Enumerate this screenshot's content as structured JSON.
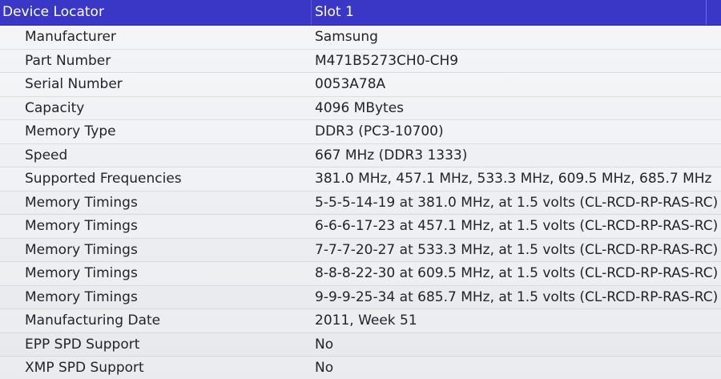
{
  "header": {
    "field": "Device Locator",
    "value": "Slot 1"
  },
  "rows": [
    {
      "field": "Manufacturer",
      "value": "Samsung"
    },
    {
      "field": "Part Number",
      "value": "M471B5273CH0-CH9"
    },
    {
      "field": "Serial Number",
      "value": "0053A78A"
    },
    {
      "field": "Capacity",
      "value": "4096 MBytes"
    },
    {
      "field": "Memory Type",
      "value": "DDR3 (PC3-10700)"
    },
    {
      "field": "Speed",
      "value": "667 MHz (DDR3 1333)"
    },
    {
      "field": "Supported Frequencies",
      "value": "381.0 MHz, 457.1 MHz, 533.3 MHz, 609.5 MHz, 685.7 MHz"
    },
    {
      "field": "Memory Timings",
      "value": "5-5-5-14-19 at 381.0 MHz, at 1.5 volts (CL-RCD-RP-RAS-RC)"
    },
    {
      "field": "Memory Timings",
      "value": "6-6-6-17-23 at 457.1 MHz, at 1.5 volts (CL-RCD-RP-RAS-RC)"
    },
    {
      "field": "Memory Timings",
      "value": "7-7-7-20-27 at 533.3 MHz, at 1.5 volts (CL-RCD-RP-RAS-RC)"
    },
    {
      "field": "Memory Timings",
      "value": "8-8-8-22-30 at 609.5 MHz, at 1.5 volts (CL-RCD-RP-RAS-RC)"
    },
    {
      "field": "Memory Timings",
      "value": "9-9-9-25-34 at 685.7 MHz, at 1.5 volts (CL-RCD-RP-RAS-RC)"
    },
    {
      "field": "Manufacturing Date",
      "value": "2011, Week 51"
    },
    {
      "field": "EPP SPD Support",
      "value": "No"
    },
    {
      "field": "XMP SPD Support",
      "value": "No"
    }
  ]
}
